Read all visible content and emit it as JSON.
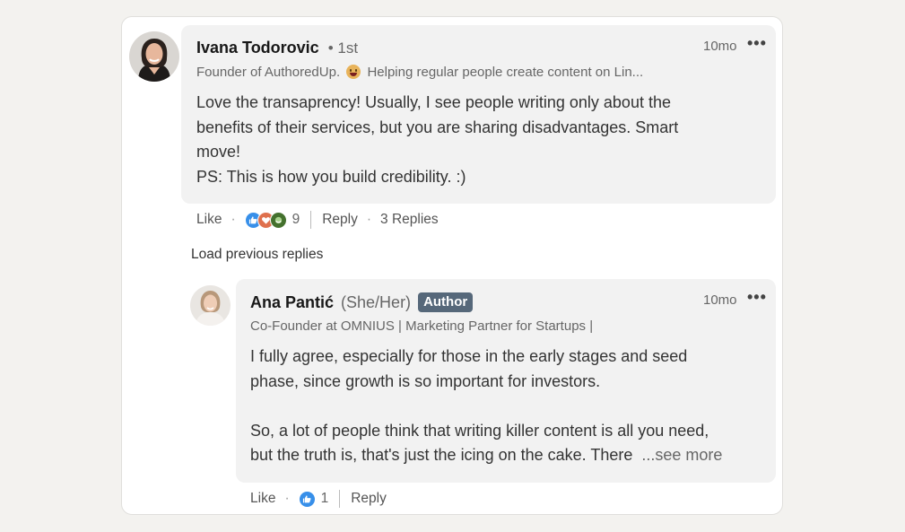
{
  "comments": [
    {
      "author_name": "Ivana Todorovic",
      "connection_degree": "• 1st",
      "headline_before_emoji": "Founder of AuthoredUp.",
      "headline_after_emoji": "Helping regular people create content on Lin...",
      "headline_emoji": "grinning-emoji",
      "time": "10mo",
      "more_icon": "more-dots-icon",
      "body_lines": [
        "Love the transaprency! Usually, I see people writing only about the",
        "benefits of their services, but you are sharing disadvantages. Smart",
        "move!",
        "PS: This is how you build credibility. :)"
      ],
      "like_label": "Like",
      "reactions": [
        "like-icon",
        "love-icon",
        "support-icon"
      ],
      "reaction_count": "9",
      "reply_label": "Reply",
      "replies_label": "3 Replies"
    }
  ],
  "load_previous_label": "Load previous replies",
  "reply": {
    "author_name": "Ana Pantić",
    "pronouns": "(She/Her)",
    "badge": "Author",
    "headline": "Co-Founder at OMNIUS | Marketing Partner for Startups |",
    "time": "10mo",
    "body_lines": [
      "I fully agree, especially for those in the early stages and seed",
      "phase, since growth is so important for investors.",
      "",
      "So, a lot of people think that writing killer content is all you need,",
      "but the truth is, that's just the icing on the cake. There"
    ],
    "see_more_label": "...see more",
    "like_label": "Like",
    "reactions": [
      "like-icon"
    ],
    "reaction_count": "1",
    "reply_label": "Reply"
  },
  "colors": {
    "like_blue": "#378fe9",
    "love_red": "#df704d",
    "support_green": "#44712e",
    "badge_bg": "#56687a"
  }
}
